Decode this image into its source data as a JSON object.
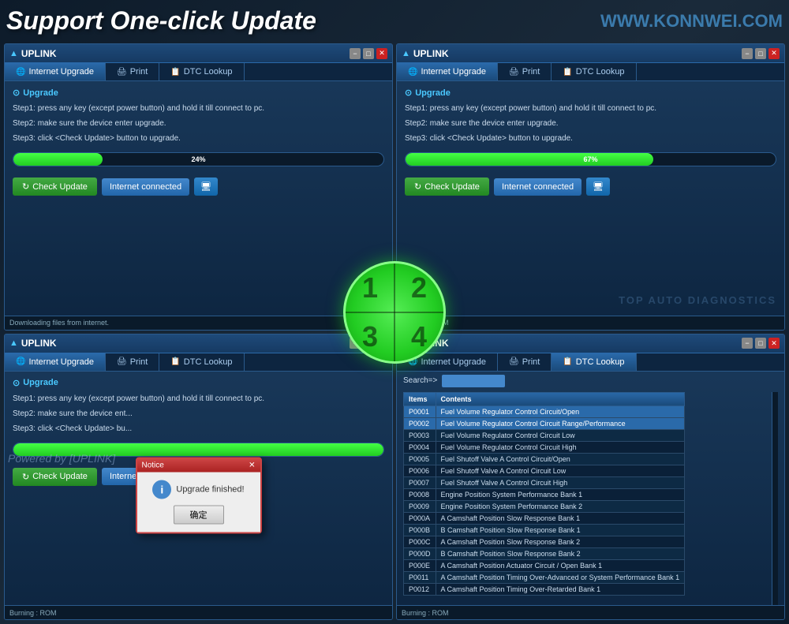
{
  "header": {
    "title": "Support One-click Update",
    "website": "WWW.KONNWEI.COM"
  },
  "powered_by": "Powered by  [UPLINK]",
  "watermark": "TOP AUTO DIAGNOSTICS",
  "window_title": "UPLINK",
  "tabs": [
    {
      "label": "Internet Upgrade",
      "icon": "🌐"
    },
    {
      "label": "Print",
      "icon": "🖨"
    },
    {
      "label": "DTC Lookup",
      "icon": "📋"
    }
  ],
  "upgrade_section": {
    "title": "Upgrade",
    "steps": [
      "Step1: press any key (except power button) and hold it till connect to pc.",
      "Step2: make sure the device enter upgrade.",
      "Step3: click <Check Update> button to upgrade."
    ]
  },
  "quadrant1": {
    "progress": 24,
    "progress_label": "24%",
    "status": "Downloading files from internet.",
    "check_update_label": "Check Update",
    "internet_label": "Internet connected"
  },
  "quadrant2": {
    "progress": 67,
    "progress_label": "67%",
    "status": "Burning : ROM",
    "check_update_label": "Check Update",
    "internet_label": "Internet connected"
  },
  "quadrant3": {
    "progress": 100,
    "progress_label": "",
    "status": "Burning : ROM",
    "check_update_label": "Check Update",
    "internet_label": "Internet connected",
    "notice": {
      "title": "Notice",
      "message": "Upgrade finished!",
      "ok_label": "确定"
    }
  },
  "quadrant4": {
    "active_tab": "DTC Lookup",
    "search_label": "Search=>",
    "columns": [
      "Items",
      "Contents"
    ],
    "rows": [
      {
        "code": "P0001",
        "desc": "Fuel Volume Regulator Control Circuit/Open",
        "highlight": true
      },
      {
        "code": "P0002",
        "desc": "Fuel Volume Regulator Control Circuit Range/Performance",
        "highlight": true
      },
      {
        "code": "P0003",
        "desc": "Fuel Volume Regulator Control Circuit Low",
        "highlight": false
      },
      {
        "code": "P0004",
        "desc": "Fuel Volume Regulator Control Circuit High",
        "highlight": false
      },
      {
        "code": "P0005",
        "desc": "Fuel Shutoff Valve A Control Circuit/Open",
        "highlight": false
      },
      {
        "code": "P0006",
        "desc": "Fuel Shutoff Valve A Control Circuit Low",
        "highlight": false
      },
      {
        "code": "P0007",
        "desc": "Fuel Shutoff Valve A Control Circuit High",
        "highlight": false
      },
      {
        "code": "P0008",
        "desc": "Engine Position System Performance Bank 1",
        "highlight": false
      },
      {
        "code": "P0009",
        "desc": "Engine Position System Performance Bank 2",
        "highlight": false
      },
      {
        "code": "P000A",
        "desc": "A Camshaft Position Slow Response Bank 1",
        "highlight": false
      },
      {
        "code": "P000B",
        "desc": "B Camshaft Position Slow Response Bank 1",
        "highlight": false
      },
      {
        "code": "P000C",
        "desc": "A Camshaft Position Slow Response Bank 2",
        "highlight": false
      },
      {
        "code": "P000D",
        "desc": "B Camshaft Position Slow Response Bank 2",
        "highlight": false
      },
      {
        "code": "P000E",
        "desc": "A Camshaft Position Actuator Circuit / Open Bank 1",
        "highlight": false
      },
      {
        "code": "P0011",
        "desc": "A Camshaft Position Timing Over-Advanced or System Performance Bank 1",
        "highlight": false
      },
      {
        "code": "P0012",
        "desc": "A Camshaft Position Timing Over-Retarded Bank 1",
        "highlight": false
      }
    ],
    "status": "Burning : ROM"
  },
  "circle": {
    "quadrants": [
      "1",
      "2",
      "3",
      "4"
    ]
  }
}
